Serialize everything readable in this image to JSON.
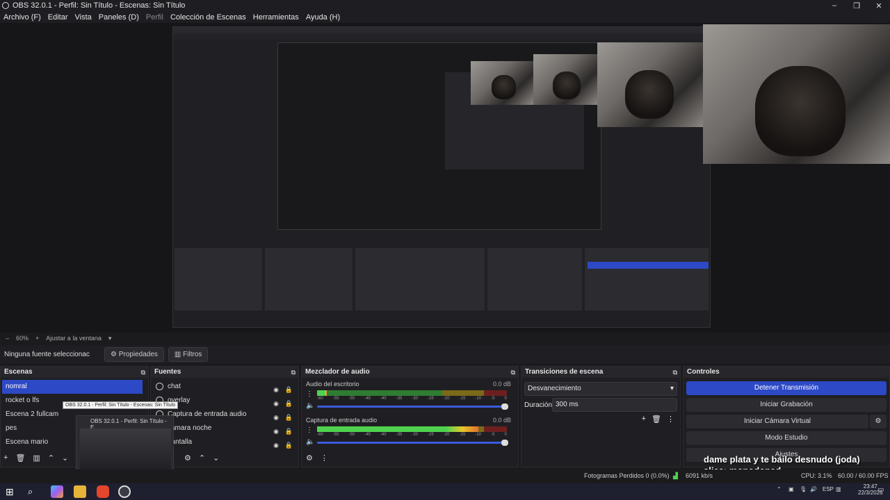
{
  "window": {
    "title": "OBS 32.0.1 - Perfil: Sin Título - Escenas: Sin Título"
  },
  "menu": [
    "Archivo (F)",
    "Editar",
    "Vista",
    "Paneles (D)",
    "Perfil",
    "Colección de Escenas",
    "Herramientas",
    "Ayuda (H)"
  ],
  "zoom": {
    "percent": "60%",
    "fit_label": "Ajustar a la ventana"
  },
  "props_bar": {
    "no_source": "Ninguna fuente seleccionac",
    "properties": "Propiedades",
    "filters": "Filtros"
  },
  "scenes": {
    "title": "Escenas",
    "items": [
      "nomral",
      "rocket o lfs",
      "Escena 2 fullcam",
      "pes",
      "Escena mario"
    ],
    "selected": 0
  },
  "sources": {
    "title": "Fuentes",
    "items": [
      "chat",
      "overlay",
      "Captura de entrada audio",
      "cámara noche",
      "pantalla"
    ]
  },
  "mixer": {
    "title": "Mezclador de audio",
    "channels": [
      {
        "name": "Audio del escritorio",
        "db": "0.0 dB",
        "level": 0.05
      },
      {
        "name": "Captura de entrada audio",
        "db": "0.0 dB",
        "level": 0.85
      }
    ],
    "scale": [
      "-60",
      "-55",
      "-50",
      "-45",
      "-40",
      "-35",
      "-30",
      "-25",
      "-20",
      "-15",
      "-10",
      "-5",
      "0"
    ]
  },
  "transitions": {
    "title": "Transiciones de escena",
    "current": "Desvanecimiento",
    "duration_label": "Duración",
    "duration": "300 ms"
  },
  "controls": {
    "title": "Controles",
    "stop_stream": "Detener Transmisión",
    "start_record": "Iniciar Grabación",
    "virtual_cam": "Iniciar Cámara Virtual",
    "studio": "Modo Estudio",
    "settings": "Ajustes"
  },
  "overlay": {
    "line1": "dame plata y te bailo desnudo (joda)",
    "line2": "alias: monodopad"
  },
  "status": {
    "dropped": "Fotogramas Perdidos 0 (0.0%)",
    "bitrate": "6091 kb/s",
    "cpu": "CPU: 3.1%",
    "fps": "60.00 / 60.00 FPS"
  },
  "tooltip": "OBS 32.0.1 - Perfil: Sin Título - Escenas: Sin Título",
  "thumbnail": {
    "title": "OBS 32.0.1 - Perfil: Sin Título - E..."
  },
  "taskbar": {
    "lang": "ESP",
    "time": "23:47",
    "date": "22/3/2026"
  }
}
